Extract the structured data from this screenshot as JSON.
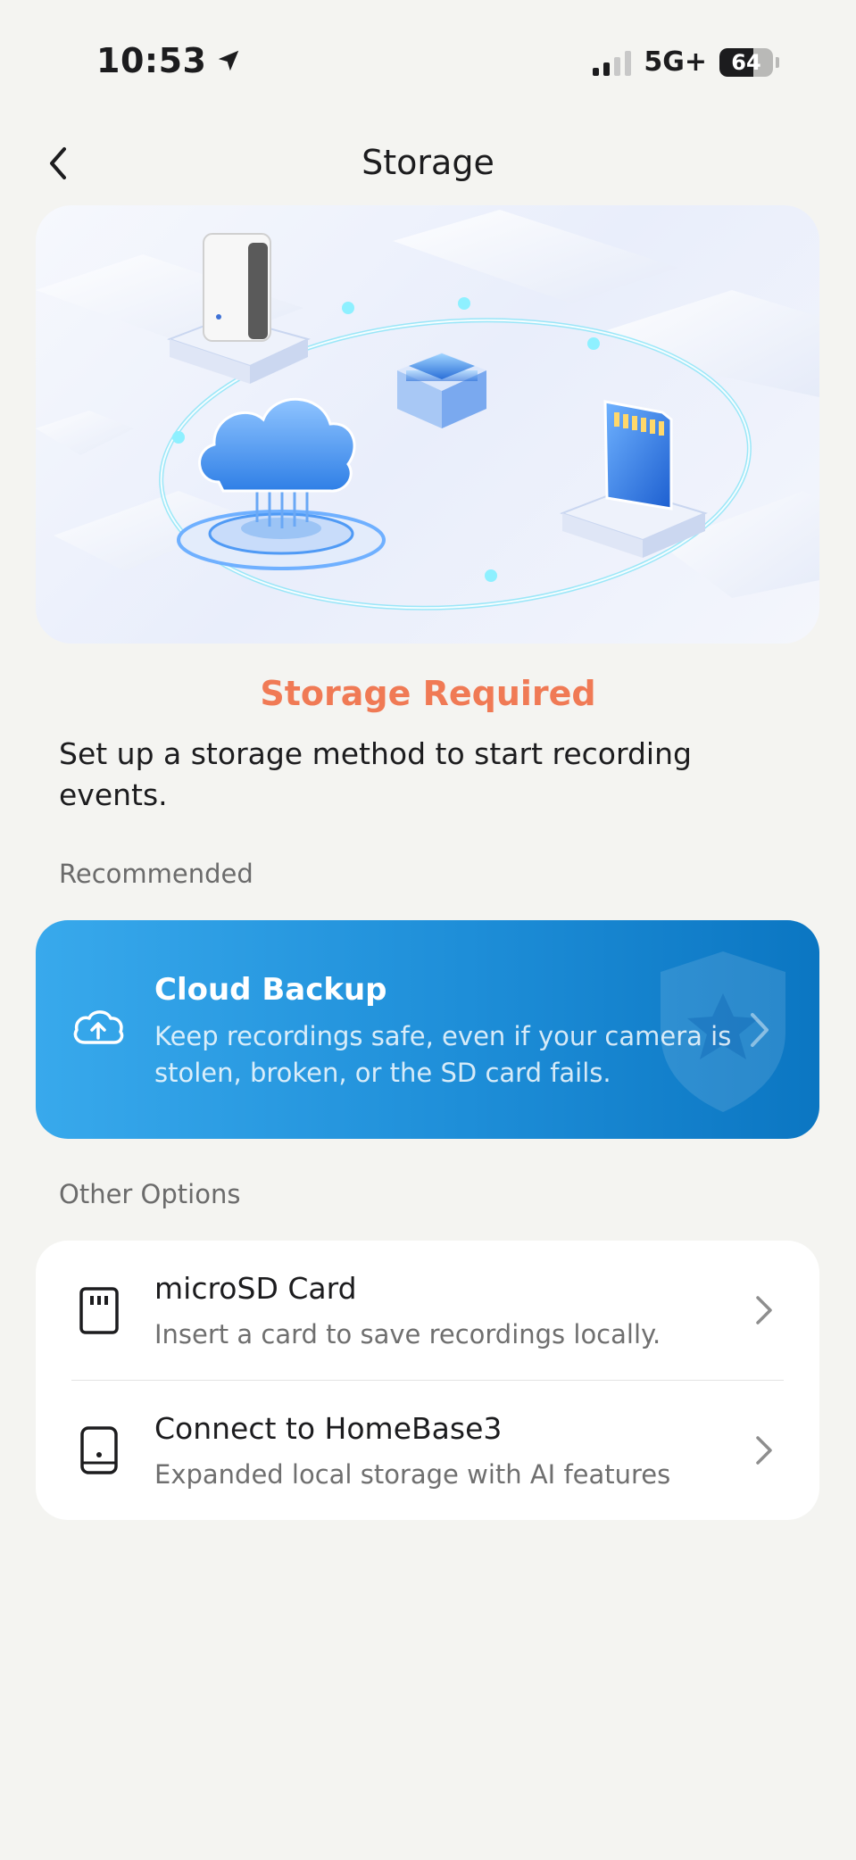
{
  "status_bar": {
    "time": "10:53",
    "network": "5G+",
    "battery": "64",
    "battery_level": 0.64
  },
  "nav": {
    "title": "Storage"
  },
  "alert": {
    "title": "Storage Required",
    "description": "Set up a storage method to start recording events."
  },
  "sections": {
    "recommended": "Recommended",
    "other": "Other Options"
  },
  "cloud_backup": {
    "title": "Cloud Backup",
    "description": "Keep recordings safe, even if your camera is stolen, broken, or the SD card fails.",
    "icon": "cloud-upload-icon"
  },
  "options": [
    {
      "title": "microSD Card",
      "description": "Insert a card to save recordings locally.",
      "icon": "sd-card-icon"
    },
    {
      "title": "Connect to HomeBase3",
      "description": "Expanded local storage with AI features",
      "icon": "homebase-icon"
    }
  ],
  "colors": {
    "accent_orange": "#f07a55",
    "card_blue": "#1e8ed8",
    "background": "#f4f4f1"
  }
}
